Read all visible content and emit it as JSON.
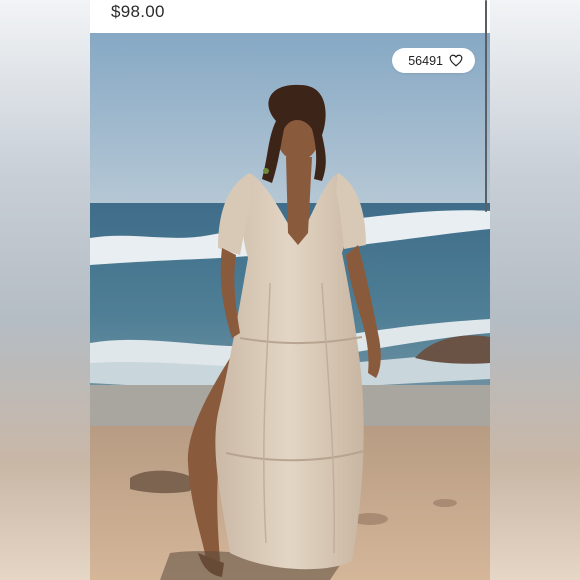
{
  "listing": {
    "price": "$98.00",
    "likes_count": "56491"
  },
  "icons": {
    "like": "heart-outline-icon"
  },
  "colors": {
    "card_background": "#ffffff",
    "price_text": "#2b2b2b"
  }
}
